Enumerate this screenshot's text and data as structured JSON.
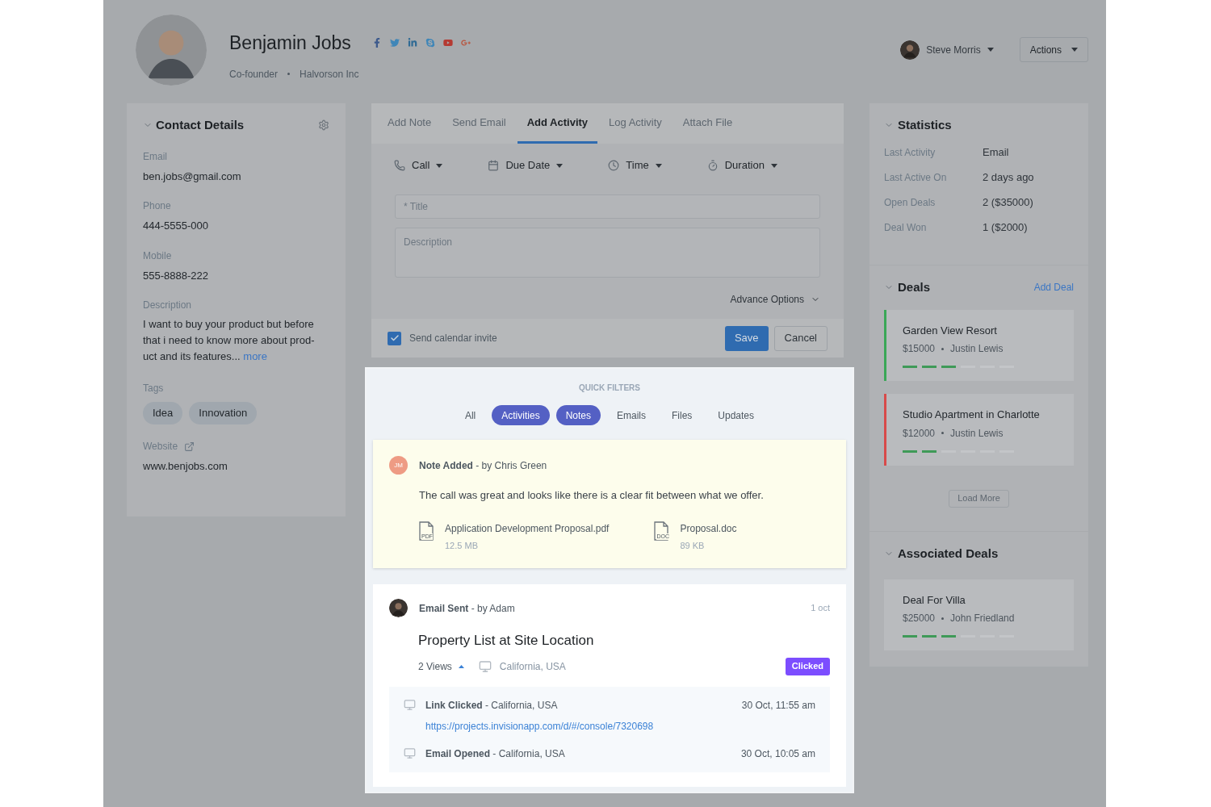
{
  "header": {
    "name": "Benjamin Jobs",
    "role": "Co-founder",
    "company": "Halvorson Inc",
    "social": [
      {
        "kind": "facebook"
      },
      {
        "kind": "twitter"
      },
      {
        "kind": "linkedin"
      },
      {
        "kind": "skype"
      },
      {
        "kind": "youtube"
      },
      {
        "kind": "googleplus"
      }
    ],
    "user_name": "Steve Morris",
    "actions": "Actions"
  },
  "contact_details": {
    "title": "Contact Details",
    "fields": [
      {
        "label": "Email",
        "value": "ben.jobs@gmail.com"
      },
      {
        "label": "Phone",
        "value": "444-5555-000"
      },
      {
        "label": "Mobile",
        "value": "555-8888-222"
      }
    ],
    "description": {
      "label": "Description",
      "text": "I want to buy your product but before that i need to know more about prod-uct and its features...",
      "link": "more"
    },
    "tags": {
      "label": "Tags",
      "items": [
        "Idea",
        "Innovation"
      ]
    },
    "website": {
      "label": "Website",
      "value": "www.benjobs.com"
    }
  },
  "activity_form": {
    "tabs": [
      {
        "label": "Add Note",
        "selected": false
      },
      {
        "label": "Send Email",
        "selected": false
      },
      {
        "label": "Add Activity",
        "selected": true
      },
      {
        "label": "Log Activity",
        "selected": false
      },
      {
        "label": "Attach File",
        "selected": false
      }
    ],
    "options": [
      {
        "kind": "phone",
        "label": "Call"
      },
      {
        "kind": "calendar",
        "label": "Due Date"
      },
      {
        "kind": "clock",
        "label": "Time"
      },
      {
        "kind": "timer",
        "label": "Duration"
      }
    ],
    "title_placeholder": "* Title",
    "description_placeholder": "Description",
    "advance_options": "Advance Options",
    "calendar_invite": {
      "label": "Send calendar invite",
      "checked": true
    },
    "save": "Save",
    "cancel": "Cancel"
  },
  "quick_filters": {
    "title": "QUICK FILTERS",
    "filters": [
      {
        "label": "All",
        "selected": false
      },
      {
        "label": "Activities",
        "selected": true
      },
      {
        "label": "Notes",
        "selected": true
      },
      {
        "label": "Emails",
        "selected": false
      },
      {
        "label": "Files",
        "selected": false
      },
      {
        "label": "Updates",
        "selected": false
      }
    ]
  },
  "timeline": [
    {
      "kind": "note",
      "initials": "JM",
      "heading": "**Note Added** - by Chris Green",
      "text": "The call was great and looks like there is a clear fit between what we offer.",
      "files": [
        {
          "type_label": "PDF",
          "name": "Application Development Proposal.pdf",
          "size": "12.5 MB"
        },
        {
          "type_label": "DOC",
          "name": "Proposal.doc",
          "size": "89 KB"
        }
      ]
    },
    {
      "kind": "email",
      "heading": "**Email Sent** - by Adam",
      "date": "1 oct",
      "subject": "Property List at Site Location",
      "views": "2 Views",
      "location": "California, USA",
      "badge": "Clicked",
      "events": [
        {
          "heading": "**Link Clicked** - California, USA",
          "time": "30 Oct, 11:55 am",
          "link": "https://projects.invisionapp.com/d/#/console/7320698"
        },
        {
          "heading": "**Email Opened** - California, USA",
          "time": "30 Oct, 10:05 am"
        }
      ]
    }
  ],
  "statistics": {
    "title": "Statistics",
    "rows": [
      {
        "label": "Last Activity",
        "value": "Email"
      },
      {
        "label": "Last Active On",
        "value": "2 days ago"
      },
      {
        "label": "Open Deals",
        "value": "2 ($35000)"
      },
      {
        "label": "Deal Won",
        "value": "1 ($2000)"
      }
    ]
  },
  "deals": {
    "title": "Deals",
    "add": "Add Deal",
    "items": [
      {
        "name": "Garden View Resort",
        "amount": "$15000",
        "owner": "Justin Lewis",
        "color": "#3aa757",
        "level": 0.5
      },
      {
        "name": "Studio Apartment in Charlotte",
        "amount": "$12000",
        "owner": "Justin Lewis",
        "color": "#d84a4a",
        "level": 0.333
      }
    ],
    "load_more": "Load More"
  },
  "associated_deals": {
    "title": "Associated Deals",
    "items": [
      {
        "name": "Deal For Villa",
        "amount": "$25000",
        "owner": "John Friedland",
        "level": 0.5
      }
    ]
  }
}
